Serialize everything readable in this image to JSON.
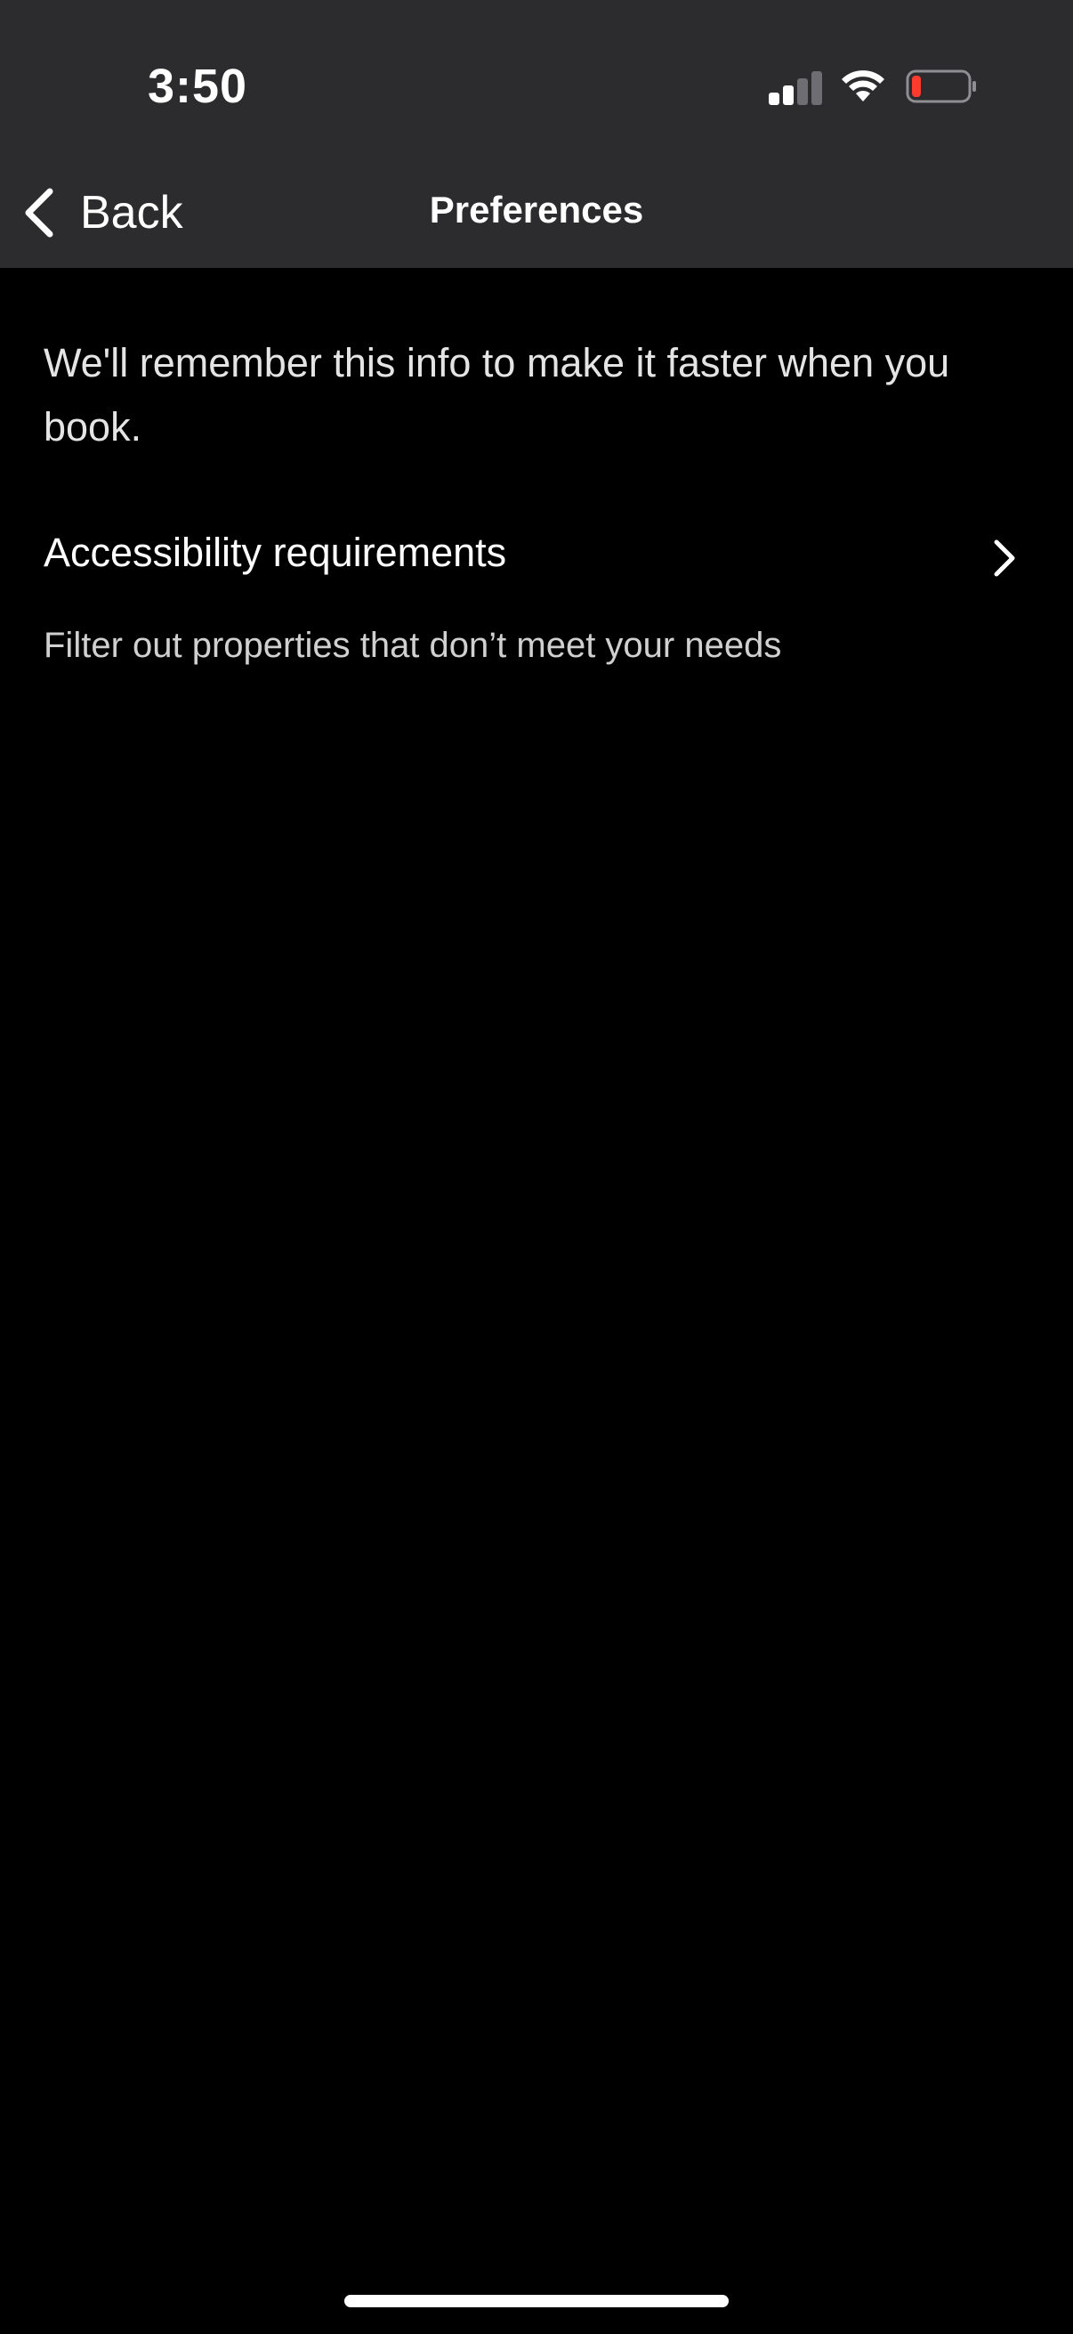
{
  "status_bar": {
    "time": "3:50",
    "signal_icon": "cellular-signal-icon",
    "signal_bars_active": 2,
    "signal_bars_total": 4,
    "wifi_icon": "wifi-icon",
    "battery_icon": "battery-low-icon",
    "battery_level_fraction": 0.12,
    "battery_color": "#ff3b30"
  },
  "nav": {
    "back_icon": "chevron-left-icon",
    "back_label": "Back",
    "title": "Preferences"
  },
  "intro_text": "We'll remember this info to make it faster when you book.",
  "preferences": [
    {
      "title": "Accessibility requirements",
      "subtitle": "Filter out properties that don’t meet your needs",
      "icon": "chevron-right-icon"
    }
  ],
  "colors": {
    "header_background": "#2c2c2e",
    "page_background": "#000000",
    "text_primary": "#ffffff"
  }
}
